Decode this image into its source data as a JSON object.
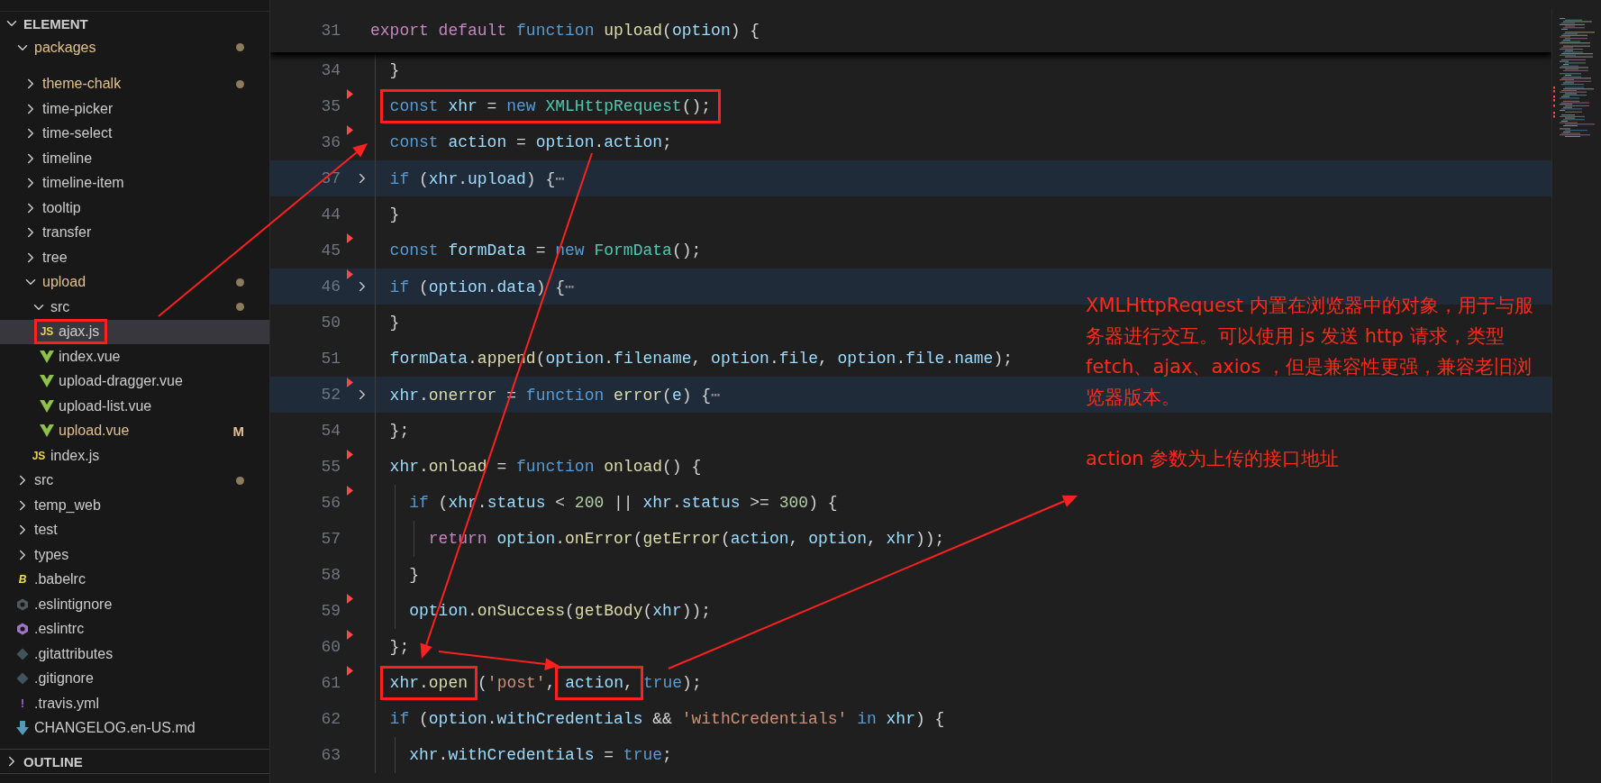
{
  "sidebar": {
    "section": {
      "title": "ELEMENT",
      "expanded": true
    },
    "tree": [
      {
        "label": "packages",
        "kind": "folder",
        "expanded": true,
        "modified": true,
        "dot": true,
        "selected": false,
        "children": [
          {
            "label": "theme-chalk",
            "kind": "folder",
            "expanded": false,
            "modified": true,
            "dot": true,
            "selected": false
          },
          {
            "label": "time-picker",
            "kind": "folder",
            "expanded": false,
            "modified": false,
            "dot": false,
            "selected": false
          },
          {
            "label": "time-select",
            "kind": "folder",
            "expanded": false,
            "modified": false,
            "dot": false,
            "selected": false
          },
          {
            "label": "timeline",
            "kind": "folder",
            "expanded": false,
            "modified": false,
            "dot": false,
            "selected": false
          },
          {
            "label": "timeline-item",
            "kind": "folder",
            "expanded": false,
            "modified": false,
            "dot": false,
            "selected": false
          },
          {
            "label": "tooltip",
            "kind": "folder",
            "expanded": false,
            "modified": false,
            "dot": false,
            "selected": false
          },
          {
            "label": "transfer",
            "kind": "folder",
            "expanded": false,
            "modified": false,
            "dot": false,
            "selected": false
          },
          {
            "label": "tree",
            "kind": "folder",
            "expanded": false,
            "modified": false,
            "dot": false,
            "selected": false
          },
          {
            "label": "upload",
            "kind": "folder",
            "expanded": true,
            "modified": true,
            "dot": true,
            "selected": false,
            "children": [
              {
                "label": "src",
                "kind": "folder",
                "expanded": true,
                "modified": false,
                "dot": true,
                "selected": false,
                "children": [
                  {
                    "label": "ajax.js",
                    "kind": "js",
                    "badge": "JS",
                    "modified": false,
                    "dot": false,
                    "selected": true,
                    "boxed": true
                  },
                  {
                    "label": "index.vue",
                    "kind": "vue",
                    "modified": false,
                    "dot": false,
                    "selected": false,
                    "boxed": false
                  },
                  {
                    "label": "upload-dragger.vue",
                    "kind": "vue",
                    "modified": false,
                    "dot": false,
                    "selected": false,
                    "boxed": false
                  },
                  {
                    "label": "upload-list.vue",
                    "kind": "vue",
                    "modified": false,
                    "dot": false,
                    "selected": false,
                    "boxed": false
                  },
                  {
                    "label": "upload.vue",
                    "kind": "vue",
                    "modified": true,
                    "dot": false,
                    "status": "M",
                    "selected": false,
                    "boxed": false
                  }
                ]
              },
              {
                "label": "index.js",
                "kind": "js",
                "badge": "JS",
                "modified": false,
                "dot": false,
                "selected": false,
                "boxed": false
              }
            ]
          }
        ]
      },
      {
        "label": "src",
        "kind": "folder",
        "expanded": false,
        "modified": false,
        "dot": true,
        "selected": false
      },
      {
        "label": "temp_web",
        "kind": "folder",
        "expanded": false,
        "modified": false,
        "dot": false,
        "selected": false
      },
      {
        "label": "test",
        "kind": "folder",
        "expanded": false,
        "modified": false,
        "dot": false,
        "selected": false
      },
      {
        "label": "types",
        "kind": "folder",
        "expanded": false,
        "modified": false,
        "dot": false,
        "selected": false
      },
      {
        "label": ".babelrc",
        "kind": "babel",
        "badge": "B",
        "modified": false,
        "dot": false,
        "selected": false,
        "boxed": false
      },
      {
        "label": ".eslintignore",
        "kind": "eslintignore",
        "modified": false,
        "dot": false,
        "selected": false,
        "boxed": false
      },
      {
        "label": ".eslintrc",
        "kind": "eslint",
        "modified": false,
        "dot": false,
        "selected": false,
        "boxed": false
      },
      {
        "label": ".gitattributes",
        "kind": "git",
        "modified": false,
        "dot": false,
        "selected": false,
        "boxed": false
      },
      {
        "label": ".gitignore",
        "kind": "git",
        "modified": false,
        "dot": false,
        "selected": false,
        "boxed": false
      },
      {
        "label": ".travis.yml",
        "kind": "yaml",
        "badge": "!",
        "modified": false,
        "dot": false,
        "selected": false,
        "boxed": false
      },
      {
        "label": "CHANGELOG.en-US.md",
        "kind": "md",
        "modified": false,
        "dot": false,
        "selected": false,
        "boxed": false
      }
    ],
    "outline": {
      "title": "OUTLINE",
      "expanded": false
    }
  },
  "editor": {
    "sticky_line": {
      "number": "31",
      "folded": false,
      "marker": false,
      "segments": [
        {
          "boxed": false,
          "tokens": [
            {
              "kind": "ctl",
              "text": "export default "
            },
            {
              "kind": "kw",
              "text": "function "
            },
            {
              "kind": "fn",
              "text": "upload"
            },
            {
              "kind": "p",
              "text": "("
            },
            {
              "kind": "var",
              "text": "option"
            },
            {
              "kind": "p",
              "text": ") {"
            }
          ]
        }
      ]
    },
    "lines": [
      {
        "number": "34",
        "folded": false,
        "marker": false,
        "segments": [
          {
            "boxed": false,
            "tokens": [
              {
                "kind": "p",
                "text": "}"
              }
            ]
          }
        ]
      },
      {
        "number": "35",
        "folded": false,
        "marker": true,
        "segments": [
          {
            "boxed": true,
            "tokens": [
              {
                "kind": "kw",
                "text": "const "
              },
              {
                "kind": "var",
                "text": "xhr"
              },
              {
                "kind": "p",
                "text": " = "
              },
              {
                "kind": "kw",
                "text": "new "
              },
              {
                "kind": "cls",
                "text": "XMLHttpRequest"
              },
              {
                "kind": "p",
                "text": "();"
              }
            ]
          }
        ]
      },
      {
        "number": "36",
        "folded": false,
        "marker": true,
        "segments": [
          {
            "boxed": false,
            "tokens": [
              {
                "kind": "kw",
                "text": "const "
              },
              {
                "kind": "var",
                "text": "action"
              },
              {
                "kind": "p",
                "text": " = "
              },
              {
                "kind": "var",
                "text": "option"
              },
              {
                "kind": "p",
                "text": "."
              },
              {
                "kind": "var",
                "text": "action"
              },
              {
                "kind": "p",
                "text": ";"
              }
            ]
          }
        ]
      },
      {
        "number": "37",
        "folded": true,
        "marker": false,
        "segments": [
          {
            "boxed": false,
            "tokens": [
              {
                "kind": "kw",
                "text": "if "
              },
              {
                "kind": "p",
                "text": "("
              },
              {
                "kind": "var",
                "text": "xhr"
              },
              {
                "kind": "p",
                "text": "."
              },
              {
                "kind": "var",
                "text": "upload"
              },
              {
                "kind": "p",
                "text": ") {"
              },
              {
                "kind": "fold",
                "text": "⋯"
              }
            ]
          }
        ]
      },
      {
        "number": "44",
        "folded": false,
        "marker": false,
        "segments": [
          {
            "boxed": false,
            "tokens": [
              {
                "kind": "p",
                "text": "}"
              }
            ]
          }
        ]
      },
      {
        "number": "45",
        "folded": false,
        "marker": true,
        "segments": [
          {
            "boxed": false,
            "tokens": [
              {
                "kind": "kw",
                "text": "const "
              },
              {
                "kind": "var",
                "text": "formData"
              },
              {
                "kind": "p",
                "text": " = "
              },
              {
                "kind": "kw",
                "text": "new "
              },
              {
                "kind": "cls",
                "text": "FormData"
              },
              {
                "kind": "p",
                "text": "();"
              }
            ]
          }
        ]
      },
      {
        "number": "46",
        "folded": true,
        "marker": true,
        "segments": [
          {
            "boxed": false,
            "tokens": [
              {
                "kind": "kw",
                "text": "if "
              },
              {
                "kind": "p",
                "text": "("
              },
              {
                "kind": "var",
                "text": "option"
              },
              {
                "kind": "p",
                "text": "."
              },
              {
                "kind": "var",
                "text": "data"
              },
              {
                "kind": "p",
                "text": ") {"
              },
              {
                "kind": "fold",
                "text": "⋯"
              }
            ]
          }
        ]
      },
      {
        "number": "50",
        "folded": false,
        "marker": false,
        "segments": [
          {
            "boxed": false,
            "tokens": [
              {
                "kind": "p",
                "text": "}"
              }
            ]
          }
        ]
      },
      {
        "number": "51",
        "folded": false,
        "marker": false,
        "segments": [
          {
            "boxed": false,
            "tokens": [
              {
                "kind": "var",
                "text": "formData"
              },
              {
                "kind": "p",
                "text": "."
              },
              {
                "kind": "fn",
                "text": "append"
              },
              {
                "kind": "p",
                "text": "("
              },
              {
                "kind": "var",
                "text": "option"
              },
              {
                "kind": "p",
                "text": "."
              },
              {
                "kind": "var",
                "text": "filename"
              },
              {
                "kind": "p",
                "text": ", "
              },
              {
                "kind": "var",
                "text": "option"
              },
              {
                "kind": "p",
                "text": "."
              },
              {
                "kind": "var",
                "text": "file"
              },
              {
                "kind": "p",
                "text": ", "
              },
              {
                "kind": "var",
                "text": "option"
              },
              {
                "kind": "p",
                "text": "."
              },
              {
                "kind": "var",
                "text": "file"
              },
              {
                "kind": "p",
                "text": "."
              },
              {
                "kind": "var",
                "text": "name"
              },
              {
                "kind": "p",
                "text": ");"
              }
            ]
          }
        ]
      },
      {
        "number": "52",
        "folded": true,
        "marker": true,
        "segments": [
          {
            "boxed": false,
            "tokens": [
              {
                "kind": "var",
                "text": "xhr"
              },
              {
                "kind": "p",
                "text": "."
              },
              {
                "kind": "fn",
                "text": "onerror"
              },
              {
                "kind": "p",
                "text": " = "
              },
              {
                "kind": "kw",
                "text": "function "
              },
              {
                "kind": "fn",
                "text": "error"
              },
              {
                "kind": "p",
                "text": "("
              },
              {
                "kind": "var",
                "text": "e"
              },
              {
                "kind": "p",
                "text": ") {"
              },
              {
                "kind": "fold",
                "text": "⋯"
              }
            ]
          }
        ]
      },
      {
        "number": "54",
        "folded": false,
        "marker": false,
        "segments": [
          {
            "boxed": false,
            "tokens": [
              {
                "kind": "p",
                "text": "};"
              }
            ]
          }
        ]
      },
      {
        "number": "55",
        "folded": false,
        "marker": true,
        "segments": [
          {
            "boxed": false,
            "tokens": [
              {
                "kind": "var",
                "text": "xhr"
              },
              {
                "kind": "p",
                "text": "."
              },
              {
                "kind": "fn",
                "text": "onload"
              },
              {
                "kind": "p",
                "text": " = "
              },
              {
                "kind": "kw",
                "text": "function "
              },
              {
                "kind": "fn",
                "text": "onload"
              },
              {
                "kind": "p",
                "text": "() {"
              }
            ]
          }
        ],
        "children": [
          {
            "number": "56",
            "folded": false,
            "marker": true,
            "segments": [
              {
                "boxed": false,
                "tokens": [
                  {
                    "kind": "kw",
                    "text": "if "
                  },
                  {
                    "kind": "p",
                    "text": "("
                  },
                  {
                    "kind": "var",
                    "text": "xhr"
                  },
                  {
                    "kind": "p",
                    "text": "."
                  },
                  {
                    "kind": "var",
                    "text": "status"
                  },
                  {
                    "kind": "p",
                    "text": " < "
                  },
                  {
                    "kind": "num",
                    "text": "200"
                  },
                  {
                    "kind": "p",
                    "text": " || "
                  },
                  {
                    "kind": "var",
                    "text": "xhr"
                  },
                  {
                    "kind": "p",
                    "text": "."
                  },
                  {
                    "kind": "var",
                    "text": "status"
                  },
                  {
                    "kind": "p",
                    "text": " >= "
                  },
                  {
                    "kind": "num",
                    "text": "300"
                  },
                  {
                    "kind": "p",
                    "text": ") {"
                  }
                ]
              }
            ],
            "children": [
              {
                "number": "57",
                "folded": false,
                "marker": false,
                "segments": [
                  {
                    "boxed": false,
                    "tokens": [
                      {
                        "kind": "ctl",
                        "text": "return "
                      },
                      {
                        "kind": "var",
                        "text": "option"
                      },
                      {
                        "kind": "p",
                        "text": "."
                      },
                      {
                        "kind": "fn",
                        "text": "onError"
                      },
                      {
                        "kind": "p",
                        "text": "("
                      },
                      {
                        "kind": "fn",
                        "text": "getError"
                      },
                      {
                        "kind": "p",
                        "text": "("
                      },
                      {
                        "kind": "var",
                        "text": "action"
                      },
                      {
                        "kind": "p",
                        "text": ", "
                      },
                      {
                        "kind": "var",
                        "text": "option"
                      },
                      {
                        "kind": "p",
                        "text": ", "
                      },
                      {
                        "kind": "var",
                        "text": "xhr"
                      },
                      {
                        "kind": "p",
                        "text": "));"
                      }
                    ]
                  }
                ]
              }
            ]
          },
          {
            "number": "58",
            "folded": false,
            "marker": false,
            "segments": [
              {
                "boxed": false,
                "tokens": [
                  {
                    "kind": "p",
                    "text": "}"
                  }
                ]
              }
            ]
          },
          {
            "number": "59",
            "folded": false,
            "marker": true,
            "segments": [
              {
                "boxed": false,
                "tokens": [
                  {
                    "kind": "var",
                    "text": "option"
                  },
                  {
                    "kind": "p",
                    "text": "."
                  },
                  {
                    "kind": "fn",
                    "text": "onSuccess"
                  },
                  {
                    "kind": "p",
                    "text": "("
                  },
                  {
                    "kind": "fn",
                    "text": "getBody"
                  },
                  {
                    "kind": "p",
                    "text": "("
                  },
                  {
                    "kind": "var",
                    "text": "xhr"
                  },
                  {
                    "kind": "p",
                    "text": "));"
                  }
                ]
              }
            ]
          }
        ]
      },
      {
        "number": "60",
        "folded": false,
        "marker": true,
        "segments": [
          {
            "boxed": false,
            "tokens": [
              {
                "kind": "p",
                "text": "};"
              }
            ]
          }
        ]
      },
      {
        "number": "61",
        "folded": false,
        "marker": true,
        "segments": [
          {
            "boxed": true,
            "tokens": [
              {
                "kind": "var",
                "text": "xhr"
              },
              {
                "kind": "p",
                "text": "."
              },
              {
                "kind": "fn",
                "text": "open"
              }
            ]
          },
          {
            "boxed": false,
            "tokens": [
              {
                "kind": "p",
                "text": "("
              },
              {
                "kind": "str",
                "text": "'post'"
              },
              {
                "kind": "p",
                "text": ", "
              }
            ]
          },
          {
            "boxed": true,
            "tokens": [
              {
                "kind": "var",
                "text": "action"
              },
              {
                "kind": "p",
                "text": ","
              }
            ]
          },
          {
            "boxed": false,
            "tokens": [
              {
                "kind": "kw",
                "text": "true"
              },
              {
                "kind": "p",
                "text": ");"
              }
            ]
          }
        ]
      },
      {
        "number": "62",
        "folded": false,
        "marker": false,
        "segments": [
          {
            "boxed": false,
            "tokens": [
              {
                "kind": "kw",
                "text": "if "
              },
              {
                "kind": "p",
                "text": "("
              },
              {
                "kind": "var",
                "text": "option"
              },
              {
                "kind": "p",
                "text": "."
              },
              {
                "kind": "var",
                "text": "withCredentials"
              },
              {
                "kind": "p",
                "text": " && "
              },
              {
                "kind": "str",
                "text": "'withCredentials'"
              },
              {
                "kind": "kw",
                "text": " in "
              },
              {
                "kind": "var",
                "text": "xhr"
              },
              {
                "kind": "p",
                "text": ") {"
              }
            ]
          }
        ],
        "children": [
          {
            "number": "63",
            "folded": false,
            "marker": false,
            "segments": [
              {
                "boxed": false,
                "tokens": [
                  {
                    "kind": "var",
                    "text": "xhr"
                  },
                  {
                    "kind": "p",
                    "text": "."
                  },
                  {
                    "kind": "var",
                    "text": "withCredentials"
                  },
                  {
                    "kind": "p",
                    "text": " = "
                  },
                  {
                    "kind": "kw",
                    "text": "true"
                  },
                  {
                    "kind": "p",
                    "text": ";"
                  }
                ]
              }
            ]
          }
        ]
      }
    ]
  },
  "annotations": [
    {
      "text": "XMLHttpRequest 内置在浏览器中的对象，用于与服务器进行交互。可以使用 js 发送 http 请求，类型 fetch、ajax、axios ，但是兼容性更强，兼容老旧浏览器版本。"
    },
    {
      "text": "action 参数为上传的接口地址"
    }
  ]
}
